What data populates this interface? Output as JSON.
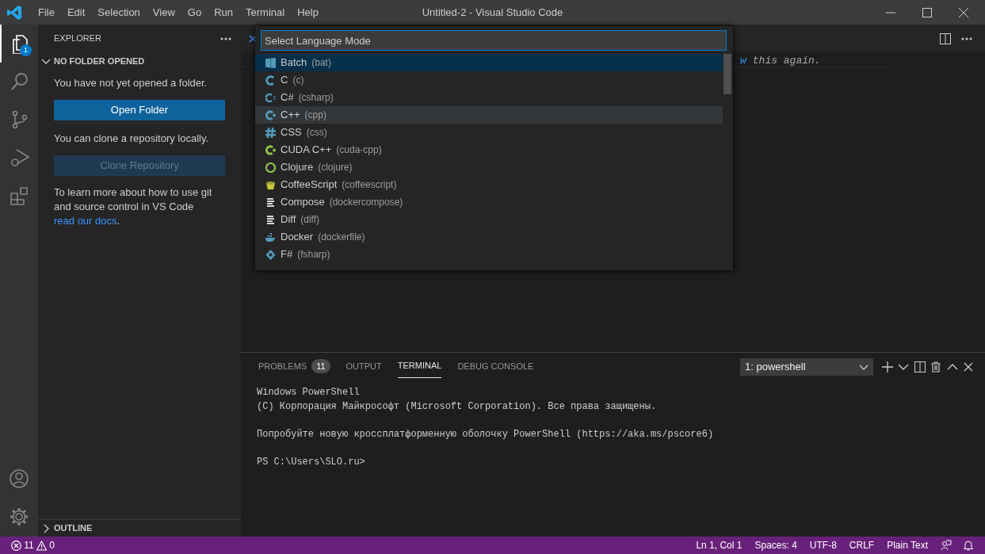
{
  "window": {
    "title": "Untitled-2 - Visual Studio Code"
  },
  "menu": [
    "File",
    "Edit",
    "Selection",
    "View",
    "Go",
    "Run",
    "Terminal",
    "Help"
  ],
  "activity_bar": {
    "top": [
      {
        "kind": "explorer",
        "selected": true,
        "badge": "1"
      },
      {
        "kind": "search",
        "selected": false
      },
      {
        "kind": "source-control",
        "selected": false
      },
      {
        "kind": "run",
        "selected": false
      },
      {
        "kind": "extensions",
        "selected": false
      }
    ],
    "bottom": [
      {
        "kind": "account"
      },
      {
        "kind": "settings"
      }
    ]
  },
  "sidebar": {
    "title": "EXPLORER",
    "section": {
      "title": "NO FOLDER OPENED",
      "expanded": true
    },
    "message": "You have not yet opened a folder.",
    "open_button": {
      "label": "Open Folder",
      "disabled": false
    },
    "clone_message": "You can clone a repository locally.",
    "clone_button": {
      "label": "Clone Repository",
      "disabled": true
    },
    "learn_text": "To learn more about how to use git and source control in VS Code",
    "learn_link": "read our docs",
    "learn_end": ".",
    "outline": {
      "title": "OUTLINE",
      "expanded": false
    }
  },
  "editor": {
    "line_fragment": "w",
    "line_text": "this again."
  },
  "quick_pick": {
    "placeholder": "Select Language Mode",
    "items": [
      {
        "label": "Batch",
        "id_text": "(bat)",
        "kind": "windows",
        "color": "#519aba",
        "selected": true,
        "hovered": false
      },
      {
        "label": "C",
        "id_text": "(c)",
        "kind": "letter-c",
        "color": "#519aba",
        "selected": false,
        "hovered": false
      },
      {
        "label": "C#",
        "id_text": "(csharp)",
        "kind": "csharp",
        "color": "#519aba",
        "selected": false,
        "hovered": false
      },
      {
        "label": "C++",
        "id_text": "(cpp)",
        "kind": "cpp",
        "color": "#519aba",
        "selected": false,
        "hovered": true
      },
      {
        "label": "CSS",
        "id_text": "(css)",
        "kind": "hash",
        "color": "#519aba",
        "selected": false,
        "hovered": false
      },
      {
        "label": "CUDA C++",
        "id_text": "(cuda-cpp)",
        "kind": "cpp",
        "color": "#8dc149",
        "selected": false,
        "hovered": false
      },
      {
        "label": "Clojure",
        "id_text": "(clojure)",
        "kind": "circle",
        "color": "#8dc149",
        "selected": false,
        "hovered": false
      },
      {
        "label": "CoffeeScript",
        "id_text": "(coffeescript)",
        "kind": "cup",
        "color": "#cbcb41",
        "selected": false,
        "hovered": false
      },
      {
        "label": "Compose",
        "id_text": "(dockercompose)",
        "kind": "lines",
        "color": "#d4d7d6",
        "selected": false,
        "hovered": false
      },
      {
        "label": "Diff",
        "id_text": "(diff)",
        "kind": "lines",
        "color": "#d4d7d6",
        "selected": false,
        "hovered": false
      },
      {
        "label": "Docker",
        "id_text": "(dockerfile)",
        "kind": "whale",
        "color": "#519aba",
        "selected": false,
        "hovered": false
      },
      {
        "label": "F#",
        "id_text": "(fsharp)",
        "kind": "diamond",
        "color": "#519aba",
        "selected": false,
        "hovered": false
      }
    ]
  },
  "panel": {
    "tabs": [
      {
        "label": "PROBLEMS",
        "badge": "11",
        "selected": false
      },
      {
        "label": "OUTPUT",
        "selected": false
      },
      {
        "label": "TERMINAL",
        "selected": true
      },
      {
        "label": "DEBUG CONSOLE",
        "selected": false
      }
    ],
    "terminal_select": "1: powershell",
    "terminal_paragraphs": [
      [
        "Windows PowerShell",
        "(C) Корпорация Майкрософт (Microsoft Corporation). Все права защищены."
      ],
      [
        "Попробуйте новую кроссплатформенную оболочку PowerShell (https://aka.ms/pscore6)"
      ],
      [
        "PS C:\\Users\\SLO.ru>"
      ]
    ]
  },
  "status_bar": {
    "errors": "11",
    "warnings": "0",
    "items": [
      "Ln 1, Col 1",
      "Spaces: 4",
      "UTF-8",
      "CRLF",
      "Plain Text"
    ]
  }
}
